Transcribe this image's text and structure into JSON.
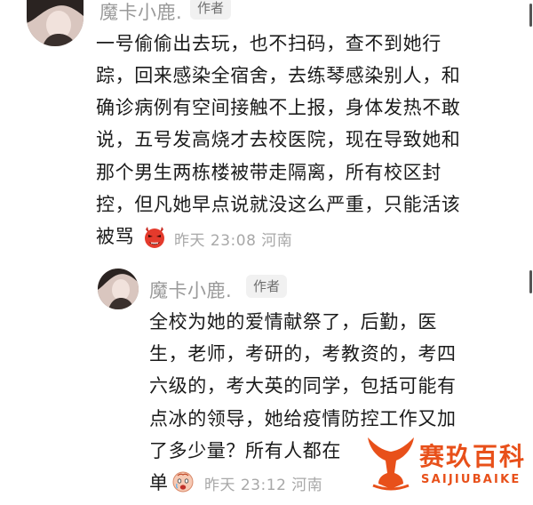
{
  "comment": {
    "author": "魔卡小鹿.",
    "badge": "作者",
    "lines": [
      "一号偷偷出去玩，也不扫码，查不到她行",
      "踪，回来感染全宿舍，去练琴感染别人，和",
      "确诊病例有空间接触不上报，身体发热不敢",
      "说，五号发高烧才去校医院，现在导致她和",
      "那个男生两栋楼被带走隔离，所有校区封",
      "控，但凡她早点说就没这么严重，只能活该",
      "被骂"
    ],
    "emoji": "angry-devil-emoji",
    "meta": "昨天 23:08 河南"
  },
  "reply": {
    "author": "魔卡小鹿.",
    "badge": "作者",
    "lines": [
      "全校为她的爱情献祭了，后勤，医",
      "生，老师，考研的，考教资的，考四",
      "六级的，考大英的同学，包括可能有",
      "点冰的领导，她给疫情防控工作又加",
      "了多少量？所有人都在",
      "单"
    ],
    "emoji": "crying-face-emoji",
    "meta": "昨天 23:12 河南"
  },
  "watermark": {
    "title": "赛玖百科",
    "subtitle": "SAIJIUBAIKE",
    "color": "#e8501a"
  }
}
